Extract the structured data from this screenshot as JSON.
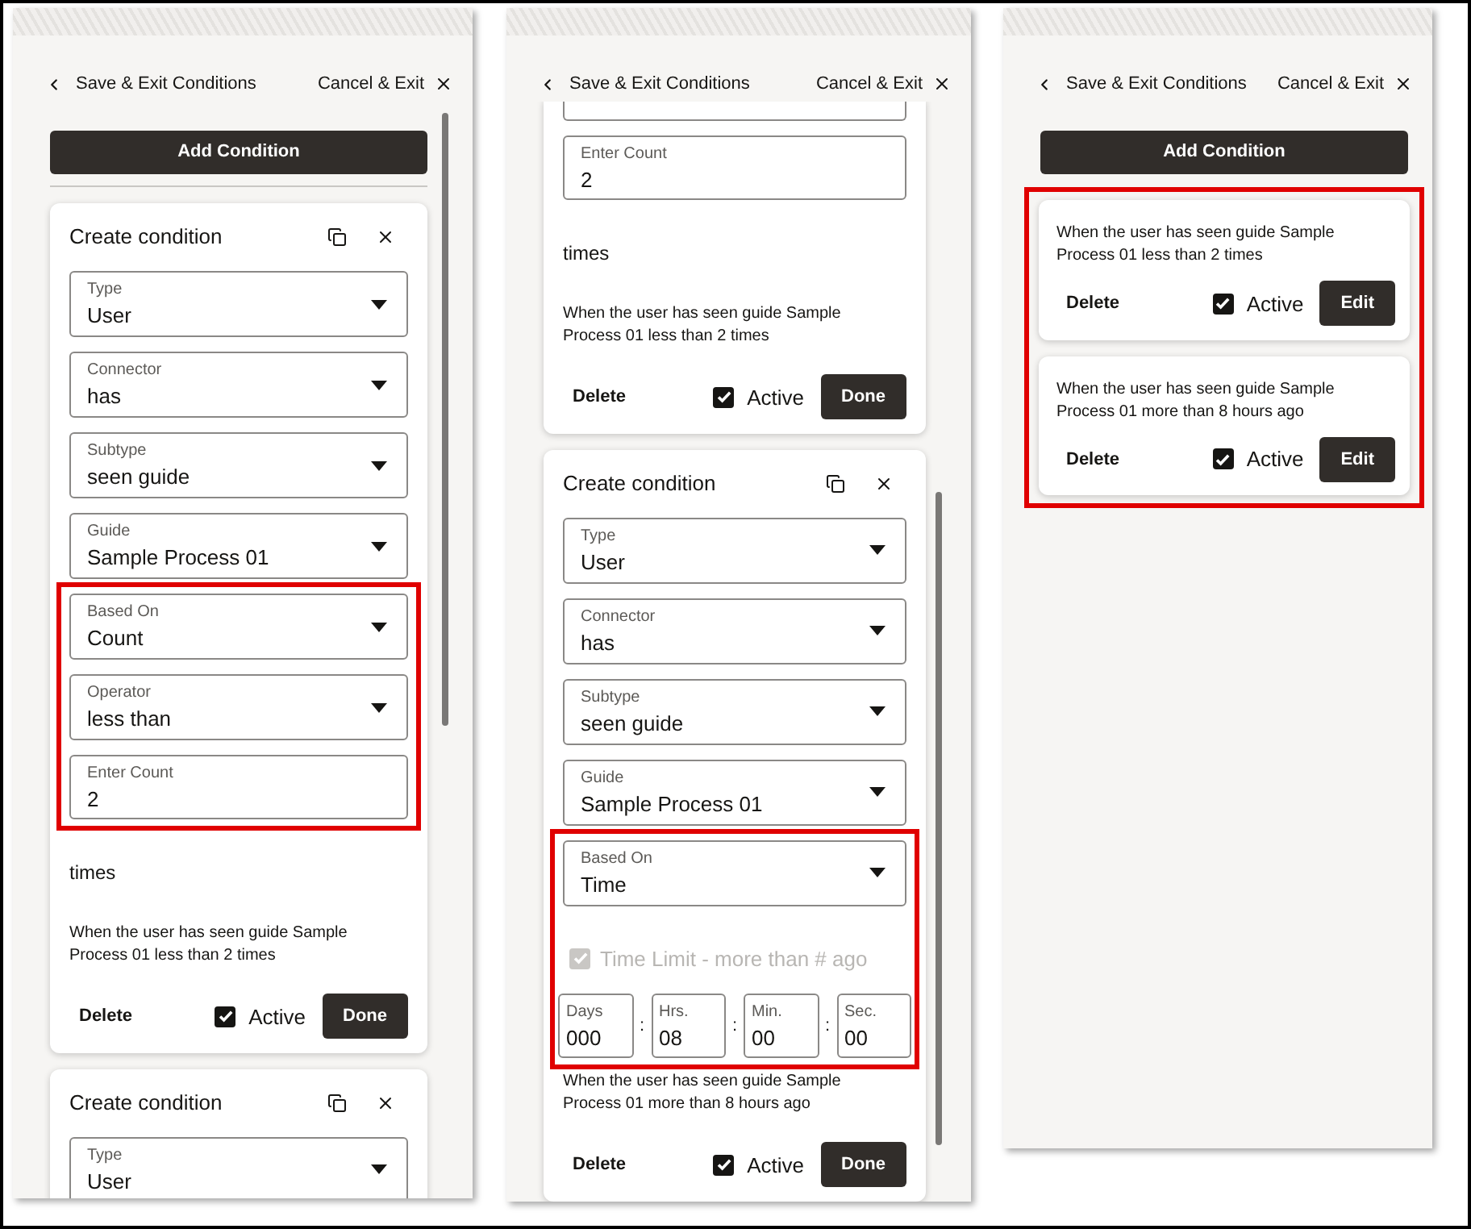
{
  "panels": [
    {
      "header": {
        "back": "Save & Exit Conditions",
        "cancel": "Cancel & Exit"
      },
      "add_button": "Add Condition",
      "scrollbar": true,
      "scrolled_past_top": false,
      "items": [
        {
          "kind": "editor",
          "clipped_top": false,
          "title": "Create condition",
          "groups": [
            {
              "highlighted": false,
              "fields": [
                {
                  "kind": "select",
                  "label": "Type",
                  "value": "User"
                },
                {
                  "kind": "select",
                  "label": "Connector",
                  "value": "has"
                },
                {
                  "kind": "select",
                  "label": "Subtype",
                  "value": "seen guide"
                },
                {
                  "kind": "select",
                  "label": "Guide",
                  "value": "Sample Process 01"
                }
              ]
            },
            {
              "highlighted": true,
              "fields": [
                {
                  "kind": "select",
                  "label": "Based On",
                  "value": "Count"
                },
                {
                  "kind": "select",
                  "label": "Operator",
                  "value": "less than"
                },
                {
                  "kind": "input",
                  "label": "Enter Count",
                  "value": "2"
                }
              ]
            }
          ],
          "unit": "times",
          "summary": "When the user has seen guide Sample Process 01 less than 2 times",
          "footer": {
            "delete": "Delete",
            "active": {
              "label": "Active",
              "checked": true
            },
            "done": "Done"
          }
        },
        {
          "kind": "editor",
          "clipped_top": false,
          "title": "Create condition",
          "groups": [
            {
              "highlighted": false,
              "fields": [
                {
                  "kind": "select",
                  "label": "Type",
                  "value": "User"
                }
              ]
            }
          ]
        }
      ]
    },
    {
      "header": {
        "back": "Save & Exit Conditions",
        "cancel": "Cancel & Exit"
      },
      "scrollbar": true,
      "scrolled_past_top": true,
      "items": [
        {
          "kind": "editor",
          "clipped_top": true,
          "groups": [
            {
              "highlighted": false,
              "fields": [
                {
                  "kind": "clipped"
                },
                {
                  "kind": "input",
                  "label": "Enter Count",
                  "value": "2"
                }
              ]
            }
          ],
          "unit": "times",
          "summary": "When the user has seen guide Sample Process 01 less than 2 times",
          "footer": {
            "delete": "Delete",
            "active": {
              "label": "Active",
              "checked": true
            },
            "done": "Done"
          }
        },
        {
          "kind": "editor",
          "clipped_top": false,
          "title": "Create condition",
          "groups": [
            {
              "highlighted": false,
              "fields": [
                {
                  "kind": "select",
                  "label": "Type",
                  "value": "User"
                },
                {
                  "kind": "select",
                  "label": "Connector",
                  "value": "has"
                },
                {
                  "kind": "select",
                  "label": "Subtype",
                  "value": "seen guide"
                },
                {
                  "kind": "select",
                  "label": "Guide",
                  "value": "Sample Process 01"
                }
              ]
            },
            {
              "highlighted": true,
              "fields": [
                {
                  "kind": "select",
                  "label": "Based On",
                  "value": "Time"
                },
                {
                  "kind": "time_limit",
                  "label": "Time Limit - more than # ago",
                  "checked": true,
                  "disabled": true,
                  "separator": ":",
                  "parts": [
                    {
                      "label": "Days",
                      "value": "000"
                    },
                    {
                      "label": "Hrs.",
                      "value": "08"
                    },
                    {
                      "label": "Min.",
                      "value": "00"
                    },
                    {
                      "label": "Sec.",
                      "value": "00"
                    }
                  ]
                }
              ]
            }
          ],
          "summary": "When the user has seen guide Sample Process 01 more than 8 hours ago",
          "footer": {
            "delete": "Delete",
            "active": {
              "label": "Active",
              "checked": true
            },
            "done": "Done"
          }
        }
      ]
    },
    {
      "header": {
        "back": "Save & Exit Conditions",
        "cancel": "Cancel & Exit"
      },
      "add_button": "Add Condition",
      "scrollbar": false,
      "scrolled_past_top": false,
      "highlight_items": true,
      "items": [
        {
          "kind": "summary",
          "summary": "When the user has seen guide Sample Process 01 less than 2 times",
          "footer": {
            "delete": "Delete",
            "active": {
              "label": "Active",
              "checked": true
            },
            "edit": "Edit"
          }
        },
        {
          "kind": "summary",
          "summary": "When the user has seen guide Sample Process 01 more than 8 hours ago",
          "footer": {
            "delete": "Delete",
            "active": {
              "label": "Active",
              "checked": true
            },
            "edit": "Edit"
          }
        }
      ]
    }
  ]
}
